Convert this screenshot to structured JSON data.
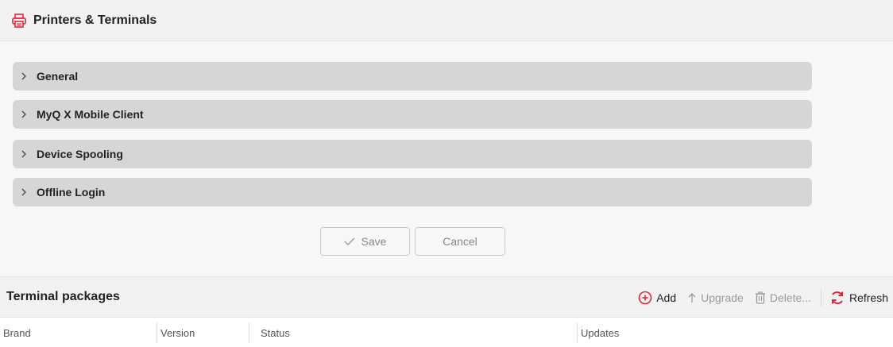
{
  "header": {
    "title": "Printers & Terminals",
    "icon": "printer-icon",
    "accent_color": "#e0263d"
  },
  "sections": [
    {
      "label": "General"
    },
    {
      "label": "MyQ X Mobile Client"
    },
    {
      "label": "Device Spooling"
    },
    {
      "label": "Offline Login"
    }
  ],
  "actions": {
    "save_label": "Save",
    "cancel_label": "Cancel"
  },
  "packages": {
    "title": "Terminal packages",
    "toolbar": {
      "add_label": "Add",
      "upgrade_label": "Upgrade",
      "delete_label": "Delete...",
      "refresh_label": "Refresh"
    },
    "columns": [
      "Brand",
      "Version",
      "Status",
      "Updates"
    ]
  }
}
